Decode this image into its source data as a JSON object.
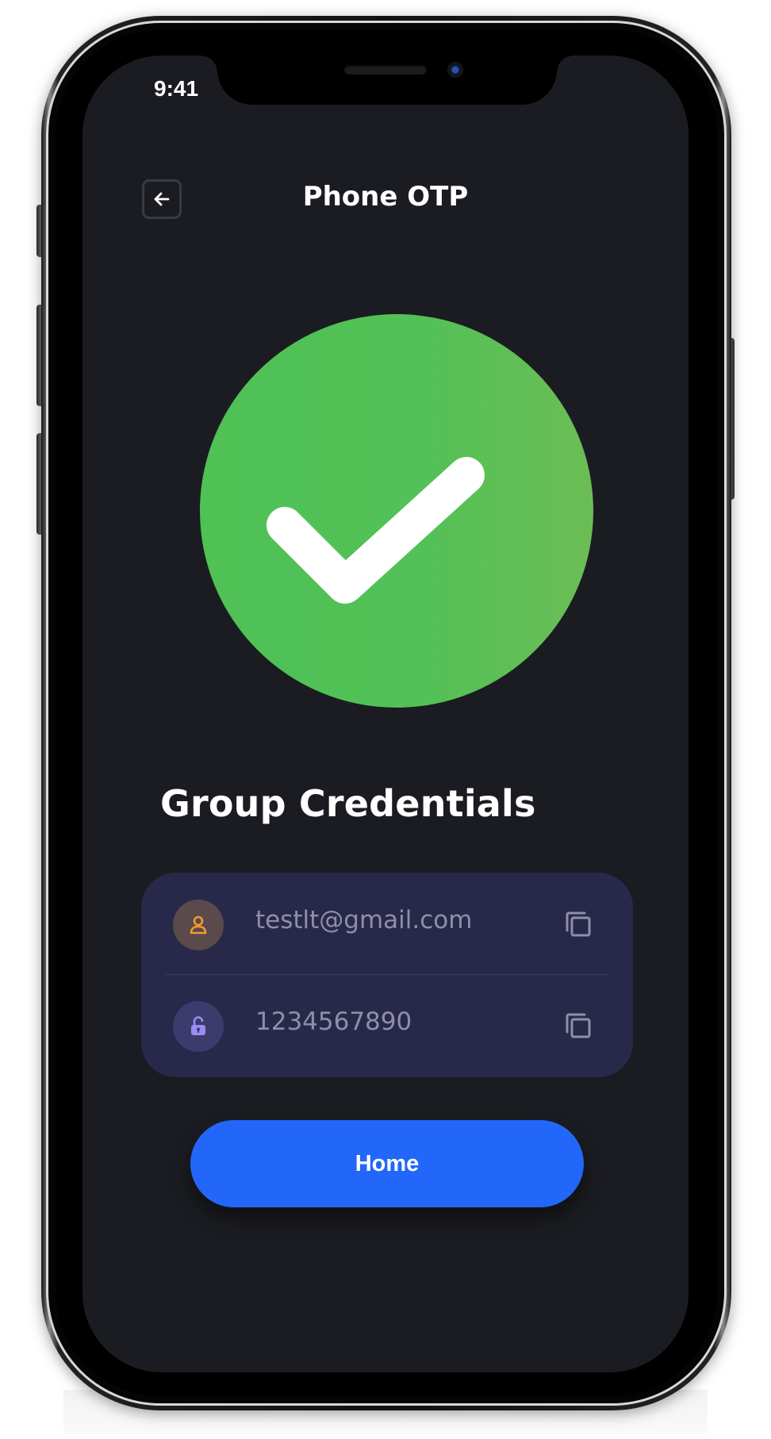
{
  "status_bar": {
    "time": "9:41"
  },
  "header": {
    "title": "Phone OTP",
    "back_icon": "arrow-left-icon"
  },
  "success": {
    "icon": "checkmark-icon",
    "color": "#52c157"
  },
  "credentials": {
    "title": "Group Credentials",
    "rows": [
      {
        "icon": "user-icon",
        "icon_color": "#f39a2e",
        "value": "testlt@gmail.com",
        "action_icon": "copy-icon"
      },
      {
        "icon": "unlock-icon",
        "icon_color": "#9b8cf2",
        "value": "1234567890",
        "action_icon": "copy-icon"
      }
    ]
  },
  "primary_button": {
    "label": "Home",
    "color": "#2367fa"
  }
}
